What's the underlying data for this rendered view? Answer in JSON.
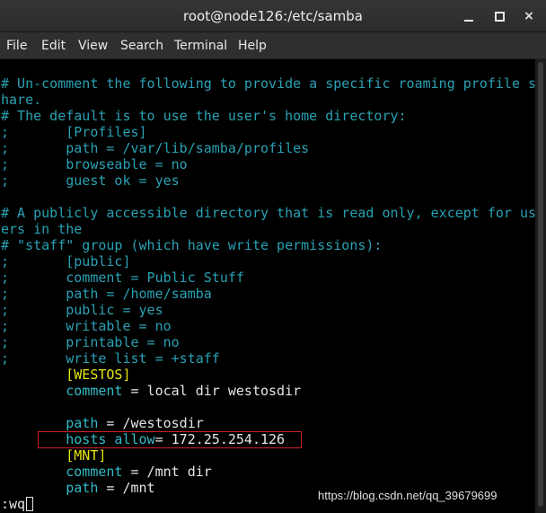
{
  "window": {
    "title": "root@node126:/etc/samba",
    "minimize_label": "",
    "maximize_label": "",
    "close_label": "×"
  },
  "menu": {
    "items": [
      "File",
      "Edit",
      "View",
      "Search",
      "Terminal",
      "Help"
    ]
  },
  "lines": [
    {
      "text": "# Un-comment the following to provide a specific roaming profile s",
      "kind": "comment"
    },
    {
      "text": "hare.",
      "kind": "comment"
    },
    {
      "text": "# The default is to use the user's home directory:",
      "kind": "comment"
    },
    {
      "text": ";       [Profiles]",
      "kind": "comment"
    },
    {
      "text": ";       path = /var/lib/samba/profiles",
      "kind": "comment"
    },
    {
      "text": ";       browseable = no",
      "kind": "comment"
    },
    {
      "text": ";       guest ok = yes",
      "kind": "comment"
    },
    {
      "text": "",
      "kind": "blank"
    },
    {
      "text": "# A publicly accessible directory that is read only, except for us",
      "kind": "comment"
    },
    {
      "text": "ers in the",
      "kind": "comment"
    },
    {
      "text": "# \"staff\" group (which have write permissions):",
      "kind": "comment"
    },
    {
      "text": ";       [public]",
      "kind": "comment"
    },
    {
      "text": ";       comment = Public Stuff",
      "kind": "comment"
    },
    {
      "text": ";       path = /home/samba",
      "kind": "comment"
    },
    {
      "text": ";       public = yes",
      "kind": "comment"
    },
    {
      "text": ";       writable = no",
      "kind": "comment"
    },
    {
      "text": ";       printable = no",
      "kind": "comment"
    },
    {
      "text": ";       write list = +staff",
      "kind": "comment"
    },
    {
      "indent": "        ",
      "section": "[WESTOS]",
      "kind": "section"
    },
    {
      "indent": "        ",
      "key": "comment",
      "rest": " = local dir westosdir",
      "kind": "setting"
    },
    {
      "text": "",
      "kind": "blank"
    },
    {
      "indent": "        ",
      "key": "path",
      "rest": " = /westosdir",
      "kind": "setting"
    },
    {
      "indent": "        ",
      "key": "hosts allow",
      "rest": "= 172.25.254.126",
      "kind": "setting"
    },
    {
      "indent": "        ",
      "section": "[MNT]",
      "kind": "section"
    },
    {
      "indent": "        ",
      "key": "comment",
      "rest": " = /mnt dir",
      "kind": "setting"
    },
    {
      "indent": "        ",
      "key": "path",
      "rest": " = /mnt",
      "kind": "setting"
    }
  ],
  "command_line": ":wq",
  "watermark": "https://blog.csdn.net/qq_39679699",
  "colors": {
    "comment": "#2aa1b3",
    "section": "#e5e510",
    "key": "#33bbc8",
    "text": "#e5e5e5",
    "highlight": "#cc2222",
    "background": "#000000"
  }
}
